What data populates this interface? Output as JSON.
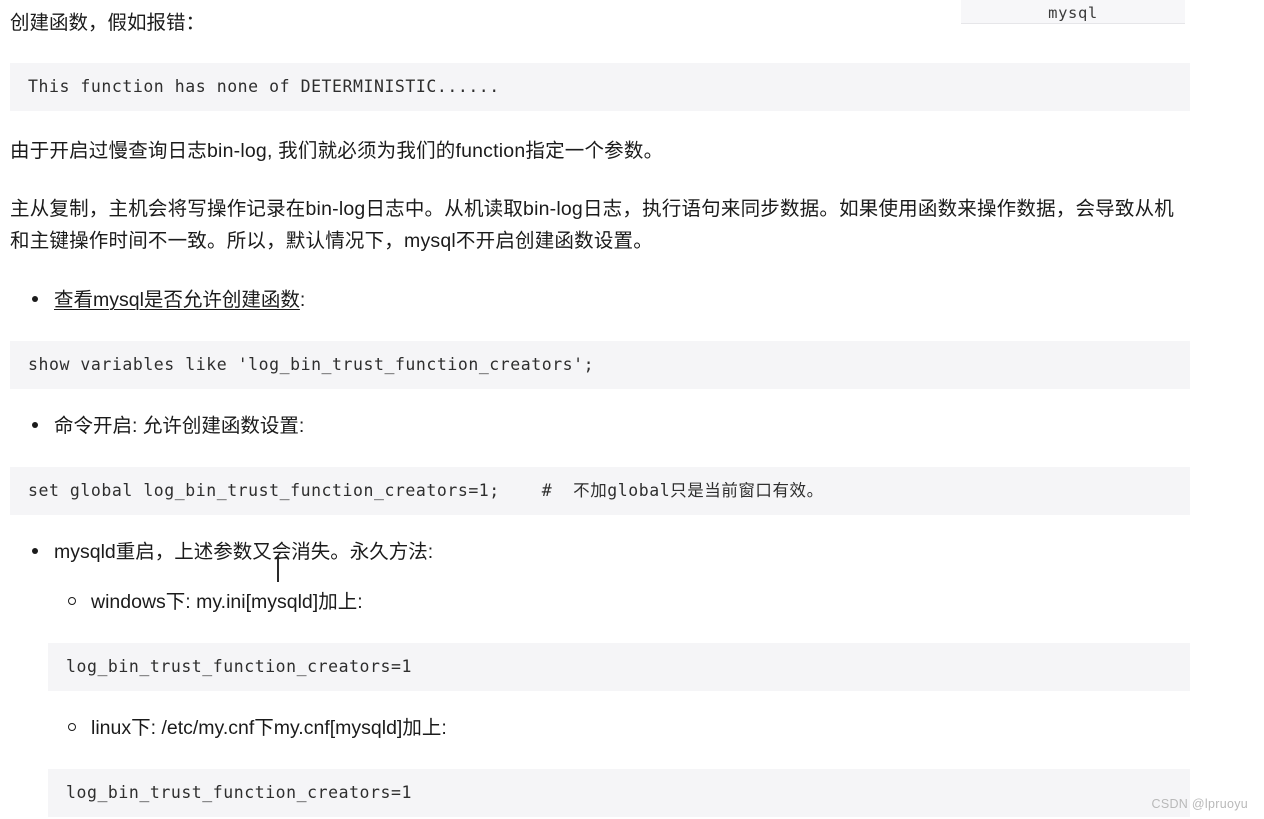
{
  "document": {
    "watermark": "CSDN @lpruoyu",
    "top_fragment_code": "mysql",
    "lead_text": "创建函数，假如报错：",
    "paragraphs": [
      "由于开启过慢查询日志bin-log, 我们就必须为我们的function指定一个参数。",
      "主从复制，主机会将写操作记录在bin-log日志中。从机读取bin-log日志，执行语句来同步数据。如果使用函数来操作数据，会导致从机和主键操作时间不一致。所以，默认情况下，mysql不开启创建函数设置。"
    ],
    "error_code": "This function has none of DETERMINISTIC......",
    "bullets": {
      "check": {
        "underlined": "查看mysql是否允许创建函数",
        "suffix": ":"
      },
      "enable": "命令开启: 允许创建函数设置:",
      "persist": "mysqld重启，上述参数又会消失。永久方法:",
      "windows": "windows下:  my.ini[mysqld]加上:",
      "linux": "linux下:  /etc/my.cnf下my.cnf[mysqld]加上:"
    },
    "code": {
      "show_variables": {
        "keyword": "show variables like ",
        "string": "'log_bin_trust_function_creators'",
        "semicolon": ";"
      },
      "set_global": {
        "statement": "set global log_bin_trust_function_creators=1;",
        "comment": "#  不加global只是当前窗口有效。"
      },
      "windows_conf": {
        "prop": "log_bin_trust_function_creators=",
        "value": "1"
      },
      "linux_conf": {
        "prop": "log_bin_trust_function_creators=",
        "value": "1"
      }
    },
    "colors": {
      "code_background": "#f5f5f7",
      "string_token": "#4aa8a0",
      "comment_token": "#c2a684",
      "property_token": "#3c3a8f",
      "number_token": "#4e4aa8",
      "text": "#1b1b1b",
      "watermark": "#b9b9b9"
    }
  }
}
